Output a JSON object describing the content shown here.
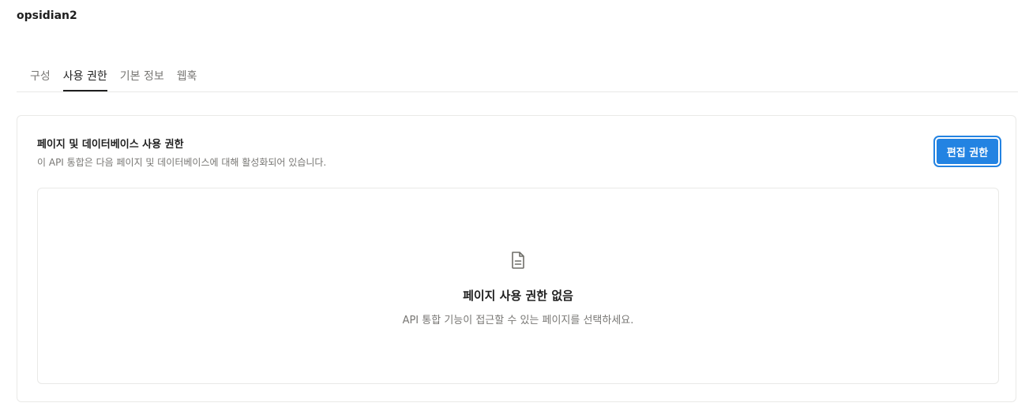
{
  "app": {
    "title": "opsidian2"
  },
  "tabs": [
    {
      "label": "구성",
      "active": false
    },
    {
      "label": "사용 권한",
      "active": true
    },
    {
      "label": "기본 정보",
      "active": false
    },
    {
      "label": "웹훅",
      "active": false
    }
  ],
  "permissions": {
    "title": "페이지 및 데이터베이스 사용 권한",
    "description": "이 API 통합은 다음 페이지 및 데이터베이스에 대해 활성화되어 있습니다.",
    "edit_button_label": "편집 권한",
    "accent_color": "#2383e2",
    "empty_state": {
      "icon": "document-icon",
      "title": "페이지 사용 권한 없음",
      "description": "API 통합 기능이 접근할 수 있는 페이지를 선택하세요."
    }
  }
}
